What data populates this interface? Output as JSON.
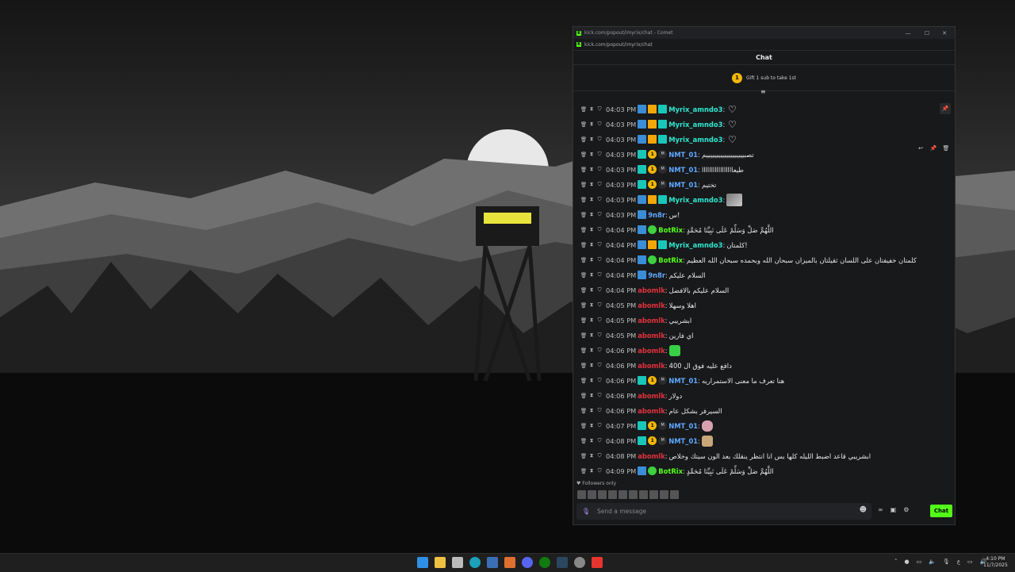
{
  "window": {
    "title": "kick.com/popout/imyrix/chat - Comet",
    "url": "kick.com/popout/imyrix/chat",
    "controls": {
      "minimize": "—",
      "maximize": "☐",
      "close": "✕"
    }
  },
  "chat": {
    "header": "Chat",
    "gift_badge": "1",
    "gift_text": "Gift 1 sub to take 1st",
    "messages": [
      {
        "time": "04:03 PM",
        "user": "Myrix_amndo3",
        "color": "#2fe6cf",
        "badges": [
          "mod",
          "crown",
          "og"
        ],
        "text": "",
        "emote": "heart"
      },
      {
        "time": "04:03 PM",
        "user": "Myrix_amndo3",
        "color": "#2fe6cf",
        "badges": [
          "mod",
          "crown",
          "og"
        ],
        "text": "",
        "emote": "heart"
      },
      {
        "time": "04:03 PM",
        "user": "Myrix_amndo3",
        "color": "#2fe6cf",
        "badges": [
          "mod",
          "crown",
          "og"
        ],
        "text": "",
        "emote": "heart"
      },
      {
        "time": "04:03 PM",
        "user": "NMT_01",
        "color": "#5fa8ff",
        "badges": [
          "og",
          "one",
          "mm"
        ],
        "text": "تصبيييييييييييييييييييم",
        "emote": ""
      },
      {
        "time": "04:03 PM",
        "user": "NMT_01",
        "color": "#5fa8ff",
        "badges": [
          "og",
          "one",
          "mm"
        ],
        "text": "طيعااااااااااااااااا",
        "emote": ""
      },
      {
        "time": "04:03 PM",
        "user": "NMT_01",
        "color": "#5fa8ff",
        "badges": [
          "og",
          "one",
          "mm"
        ],
        "text": "تختيم",
        "emote": ""
      },
      {
        "time": "04:03 PM",
        "user": "Myrix_amndo3",
        "color": "#2fe6cf",
        "badges": [
          "mod",
          "crown",
          "og"
        ],
        "text": "",
        "emote": "img"
      },
      {
        "time": "04:03 PM",
        "user": "9n8r",
        "color": "#5fa8ff",
        "badges": [
          "mod"
        ],
        "text": "س!",
        "emote": ""
      },
      {
        "time": "04:04 PM",
        "user": "BotRix",
        "color": "#53fc18",
        "badges": [
          "mod",
          "ver"
        ],
        "text": "اللَّهُمَّ صَلِّ وَسَلِّمْ عَلَى نَبِيِّنَا مُحَمَّدٍ",
        "emote": ""
      },
      {
        "time": "04:04 PM",
        "user": "Myrix_amndo3",
        "color": "#2fe6cf",
        "badges": [
          "mod",
          "crown",
          "og"
        ],
        "text": "كلمتان!",
        "emote": ""
      },
      {
        "time": "04:04 PM",
        "user": "BotRix",
        "color": "#53fc18",
        "badges": [
          "mod",
          "ver"
        ],
        "text": "كلمتان خفيفتان على اللسان ثقيلتان بالميزان سبحان الله وبحمده سبحان الله العظيم",
        "emote": ""
      },
      {
        "time": "04:04 PM",
        "user": "9n8r",
        "color": "#5fa8ff",
        "badges": [
          "mod"
        ],
        "text": "السلام عليكم",
        "emote": ""
      },
      {
        "time": "04:04 PM",
        "user": "abomlk",
        "color": "#e0323c",
        "badges": [],
        "text": "السلام عليكم بالافضل",
        "emote": ""
      },
      {
        "time": "04:05 PM",
        "user": "abomlk",
        "color": "#e0323c",
        "badges": [],
        "text": "اهلا وسهلا",
        "emote": ""
      },
      {
        "time": "04:05 PM",
        "user": "abomlk",
        "color": "#e0323c",
        "badges": [],
        "text": "ابشريبي",
        "emote": ""
      },
      {
        "time": "04:05 PM",
        "user": "abomlk",
        "color": "#e0323c",
        "badges": [],
        "text": "اي فارين",
        "emote": ""
      },
      {
        "time": "04:06 PM",
        "user": "abomlk",
        "color": "#e0323c",
        "badges": [],
        "text": "",
        "emote": "green"
      },
      {
        "time": "04:06 PM",
        "user": "abomlk",
        "color": "#e0323c",
        "badges": [],
        "text": "دافع عليه فوق ال 400",
        "emote": ""
      },
      {
        "time": "04:06 PM",
        "user": "NMT_01",
        "color": "#5fa8ff",
        "badges": [
          "og",
          "one",
          "mm"
        ],
        "text": "هنا تعرف ما معنى الاستمراريه",
        "emote": ""
      },
      {
        "time": "04:06 PM",
        "user": "abomlk",
        "color": "#e0323c",
        "badges": [],
        "text": "دولار",
        "emote": ""
      },
      {
        "time": "04:06 PM",
        "user": "abomlk",
        "color": "#e0323c",
        "badges": [],
        "text": "السيرفر بشكل عام",
        "emote": ""
      },
      {
        "time": "04:07 PM",
        "user": "NMT_01",
        "color": "#5fa8ff",
        "badges": [
          "og",
          "one",
          "mm"
        ],
        "text": "",
        "emote": "pink"
      },
      {
        "time": "04:08 PM",
        "user": "NMT_01",
        "color": "#5fa8ff",
        "badges": [
          "og",
          "one",
          "mm"
        ],
        "text": "",
        "emote": "tan"
      },
      {
        "time": "04:08 PM",
        "user": "abomlk",
        "color": "#e0323c",
        "badges": [],
        "text": "ابشريبي قاعد اضبط الليله كلها بس انا انتظر ينقلك بعد الون سيتك وخلاص",
        "emote": ""
      },
      {
        "time": "04:09 PM",
        "user": "BotRix",
        "color": "#53fc18",
        "badges": [
          "mod",
          "ver"
        ],
        "text": "اللَّهُمَّ صَلِّ وَسَلِّمْ عَلَى نَبِيِّنَا مُحَمَّدٍ",
        "emote": ""
      }
    ],
    "followers_only": "♥ Followers only",
    "input_placeholder": "Send a message",
    "chat_button": "Chat"
  },
  "taskbar": {
    "time": "4:10 PM",
    "date": "11/7/2025",
    "lang": "ع"
  },
  "colors": {
    "accent": "#53fc18"
  }
}
